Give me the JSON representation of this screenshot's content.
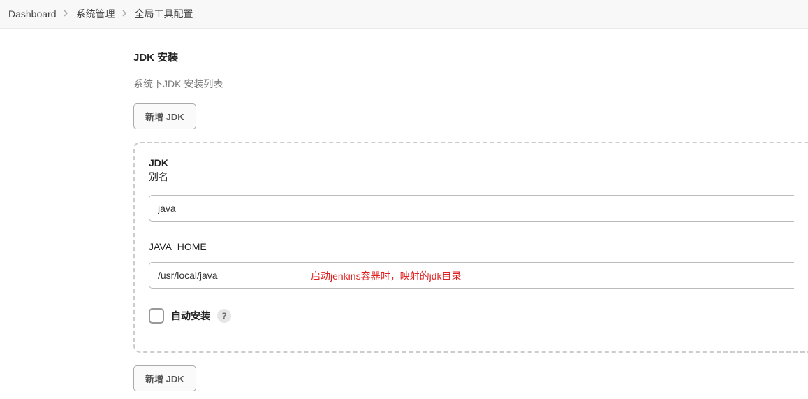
{
  "breadcrumb": {
    "items": [
      {
        "label": "Dashboard"
      },
      {
        "label": "系统管理"
      },
      {
        "label": "全局工具配置"
      }
    ]
  },
  "section": {
    "title": "JDK 安装",
    "subtitle": "系统下JDK 安装列表",
    "add_button_label": "新增 JDK"
  },
  "jdk": {
    "heading": "JDK",
    "alias_label": "别名",
    "alias_value": "java",
    "java_home_label": "JAVA_HOME",
    "java_home_value": "/usr/local/java",
    "annotation": "启动jenkins容器时，映射的jdk目录",
    "auto_install_label": "自动安装",
    "auto_install_checked": false,
    "help_glyph": "?"
  },
  "footer": {
    "add_button_label": "新增 JDK"
  }
}
